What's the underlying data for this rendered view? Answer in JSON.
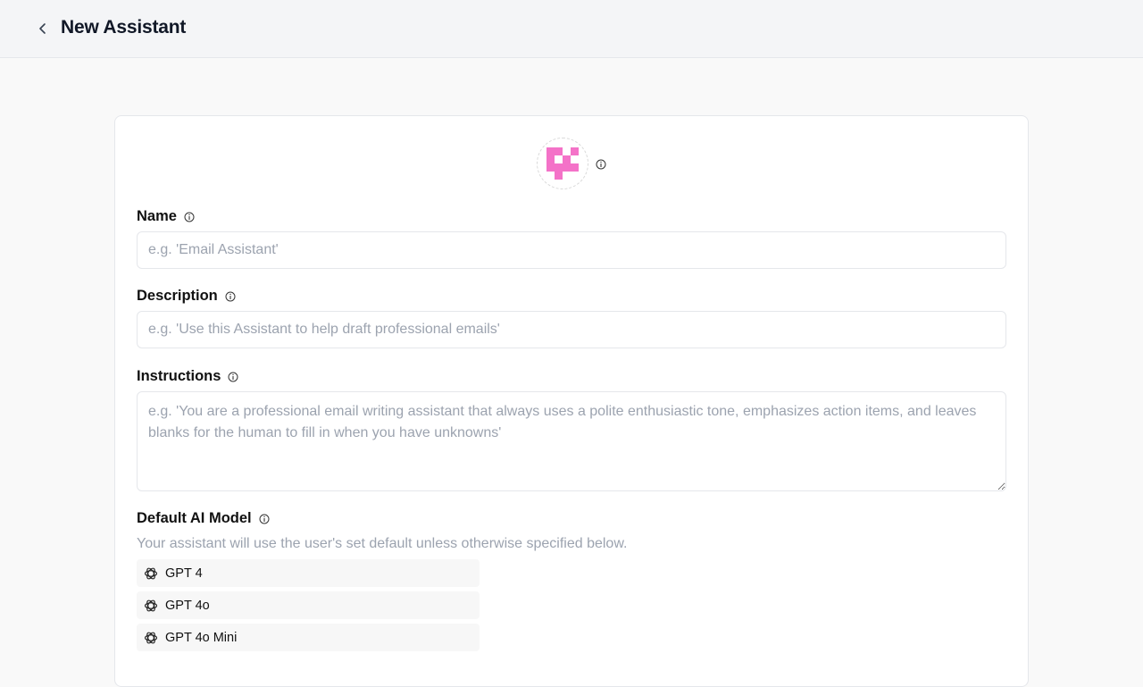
{
  "header": {
    "title": "New Assistant"
  },
  "form": {
    "name": {
      "label": "Name",
      "placeholder": "e.g. 'Email Assistant'"
    },
    "description": {
      "label": "Description",
      "placeholder": "e.g. 'Use this Assistant to help draft professional emails'"
    },
    "instructions": {
      "label": "Instructions",
      "placeholder": "e.g. 'You are a professional email writing assistant that always uses a polite enthusiastic tone, emphasizes action items, and leaves blanks for the human to fill in when you have unknowns'"
    },
    "model": {
      "label": "Default AI Model",
      "subtext": "Your assistant will use the user's set default unless otherwise specified below.",
      "options": [
        {
          "label": "GPT 4",
          "icon": "openai-icon"
        },
        {
          "label": "GPT 4o",
          "icon": "openai-icon"
        },
        {
          "label": "GPT 4o Mini",
          "icon": "openai-icon"
        }
      ]
    }
  },
  "colors": {
    "avatar": "#f472c8",
    "header_bg": "#f4f5f7",
    "page_bg": "#f9f9f9"
  }
}
